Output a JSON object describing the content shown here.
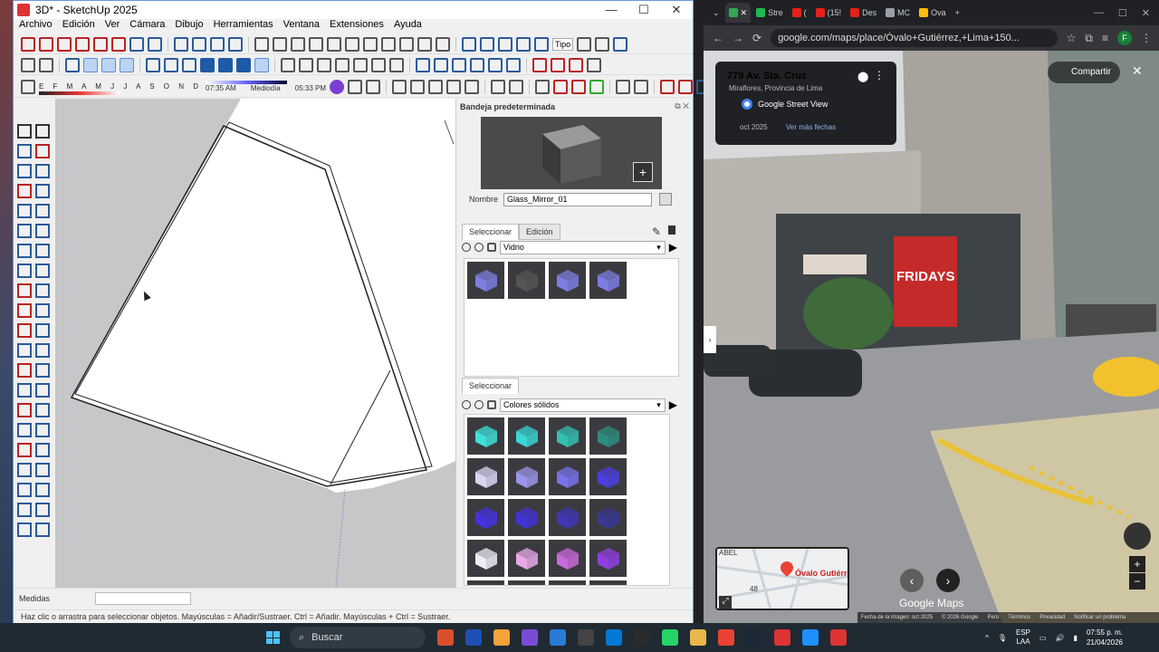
{
  "sketchup": {
    "title": "3D* - SketchUp 2025",
    "menu": [
      "Archivo",
      "Edición",
      "Ver",
      "Cámara",
      "Dibujo",
      "Herramientas",
      "Ventana",
      "Extensiones",
      "Ayuda"
    ],
    "toolbar": {
      "shadow_months": "E F M A M J J A S O N D",
      "time_start": "07:35 AM",
      "time_mid": "Mediodía",
      "time_end": "05:33 PM",
      "tipo_label": "Tipo"
    },
    "tray": {
      "title": "Bandeja predeterminada",
      "name_label": "Nombre",
      "material_name": "Glass_Mirror_01",
      "tab_select": "Seleccionar",
      "tab_edit": "Edición",
      "library1": "Vidrio",
      "tab_select2": "Seleccionar",
      "library2": "Colores sólidos",
      "glass_swatches": [
        "#7b7ee0",
        "#555",
        "#7b7ee0",
        "#7b7ee0"
      ],
      "solid_swatches": [
        "#3fe0d8",
        "#3ad5d5",
        "#33c2b0",
        "#2e8c7e",
        "#d9d6f2",
        "#9a95ea",
        "#7873ea",
        "#4b3fe0",
        "#4533e0",
        "#4233d6",
        "#3f36b8",
        "#3a3790",
        "#f0ecf5",
        "#e8a9ea",
        "#c86ad9",
        "#8f3fe0",
        "#8a3fe0",
        "#6a2fd0",
        "#5a35a8",
        "#4b3a80"
      ]
    },
    "measure_label": "Medidas",
    "status": "Haz clic o arrastra para seleccionar objetos. Mayúsculas = Añadir/Sustraer. Ctrl = Añadir. Mayúsculas + Ctrl = Sustraer."
  },
  "chrome": {
    "tabs": [
      {
        "label": "Stre",
        "color": "#1db954"
      },
      {
        "label": "(",
        "color": "#e62117"
      },
      {
        "label": "(15!",
        "color": "#e62117"
      },
      {
        "label": "Des",
        "color": "#e62117"
      },
      {
        "label": "MC",
        "color": "#9aa0a6"
      },
      {
        "label": "Ova",
        "color": "#ffbc0d"
      }
    ],
    "url": "google.com/maps/place/Óvalo+Gutiérrez,+Lima+150...",
    "profile_initial": "F"
  },
  "streetview": {
    "address": "779 Av. Sta. Cruz",
    "locality": "Miraflores, Provincia de Lima",
    "source_label": "Google Street View",
    "date": "oct 2025",
    "more_dates": "Ver más fechas",
    "share": "Compartir",
    "map_place": "Óvalo Gutiérre",
    "map_street": "ABEL",
    "map_number": "48",
    "brand": "Google Maps",
    "footer": [
      "Fecha de la imagen: oct 2025",
      "© 2026 Google",
      "Perú",
      "Términos",
      "Privacidad",
      "Notificar un problema"
    ],
    "sign_fridays": "FRIDAYS"
  },
  "taskbar": {
    "search": "Buscar",
    "lang": "ESP",
    "lang2": "LAA",
    "time": "07:55 p. m.",
    "date": "21/04/2026",
    "apps": [
      "#d94f2c",
      "#1e4fb3",
      "#f4a23a",
      "#7b4bd6",
      "#2a7bd6",
      "#444",
      "#0078d4",
      "#2b2b2b",
      "#25d366",
      "#e8b84a",
      "#ea4335",
      "#1b2838",
      "#d33",
      "#1e90ff",
      "#d33"
    ]
  }
}
